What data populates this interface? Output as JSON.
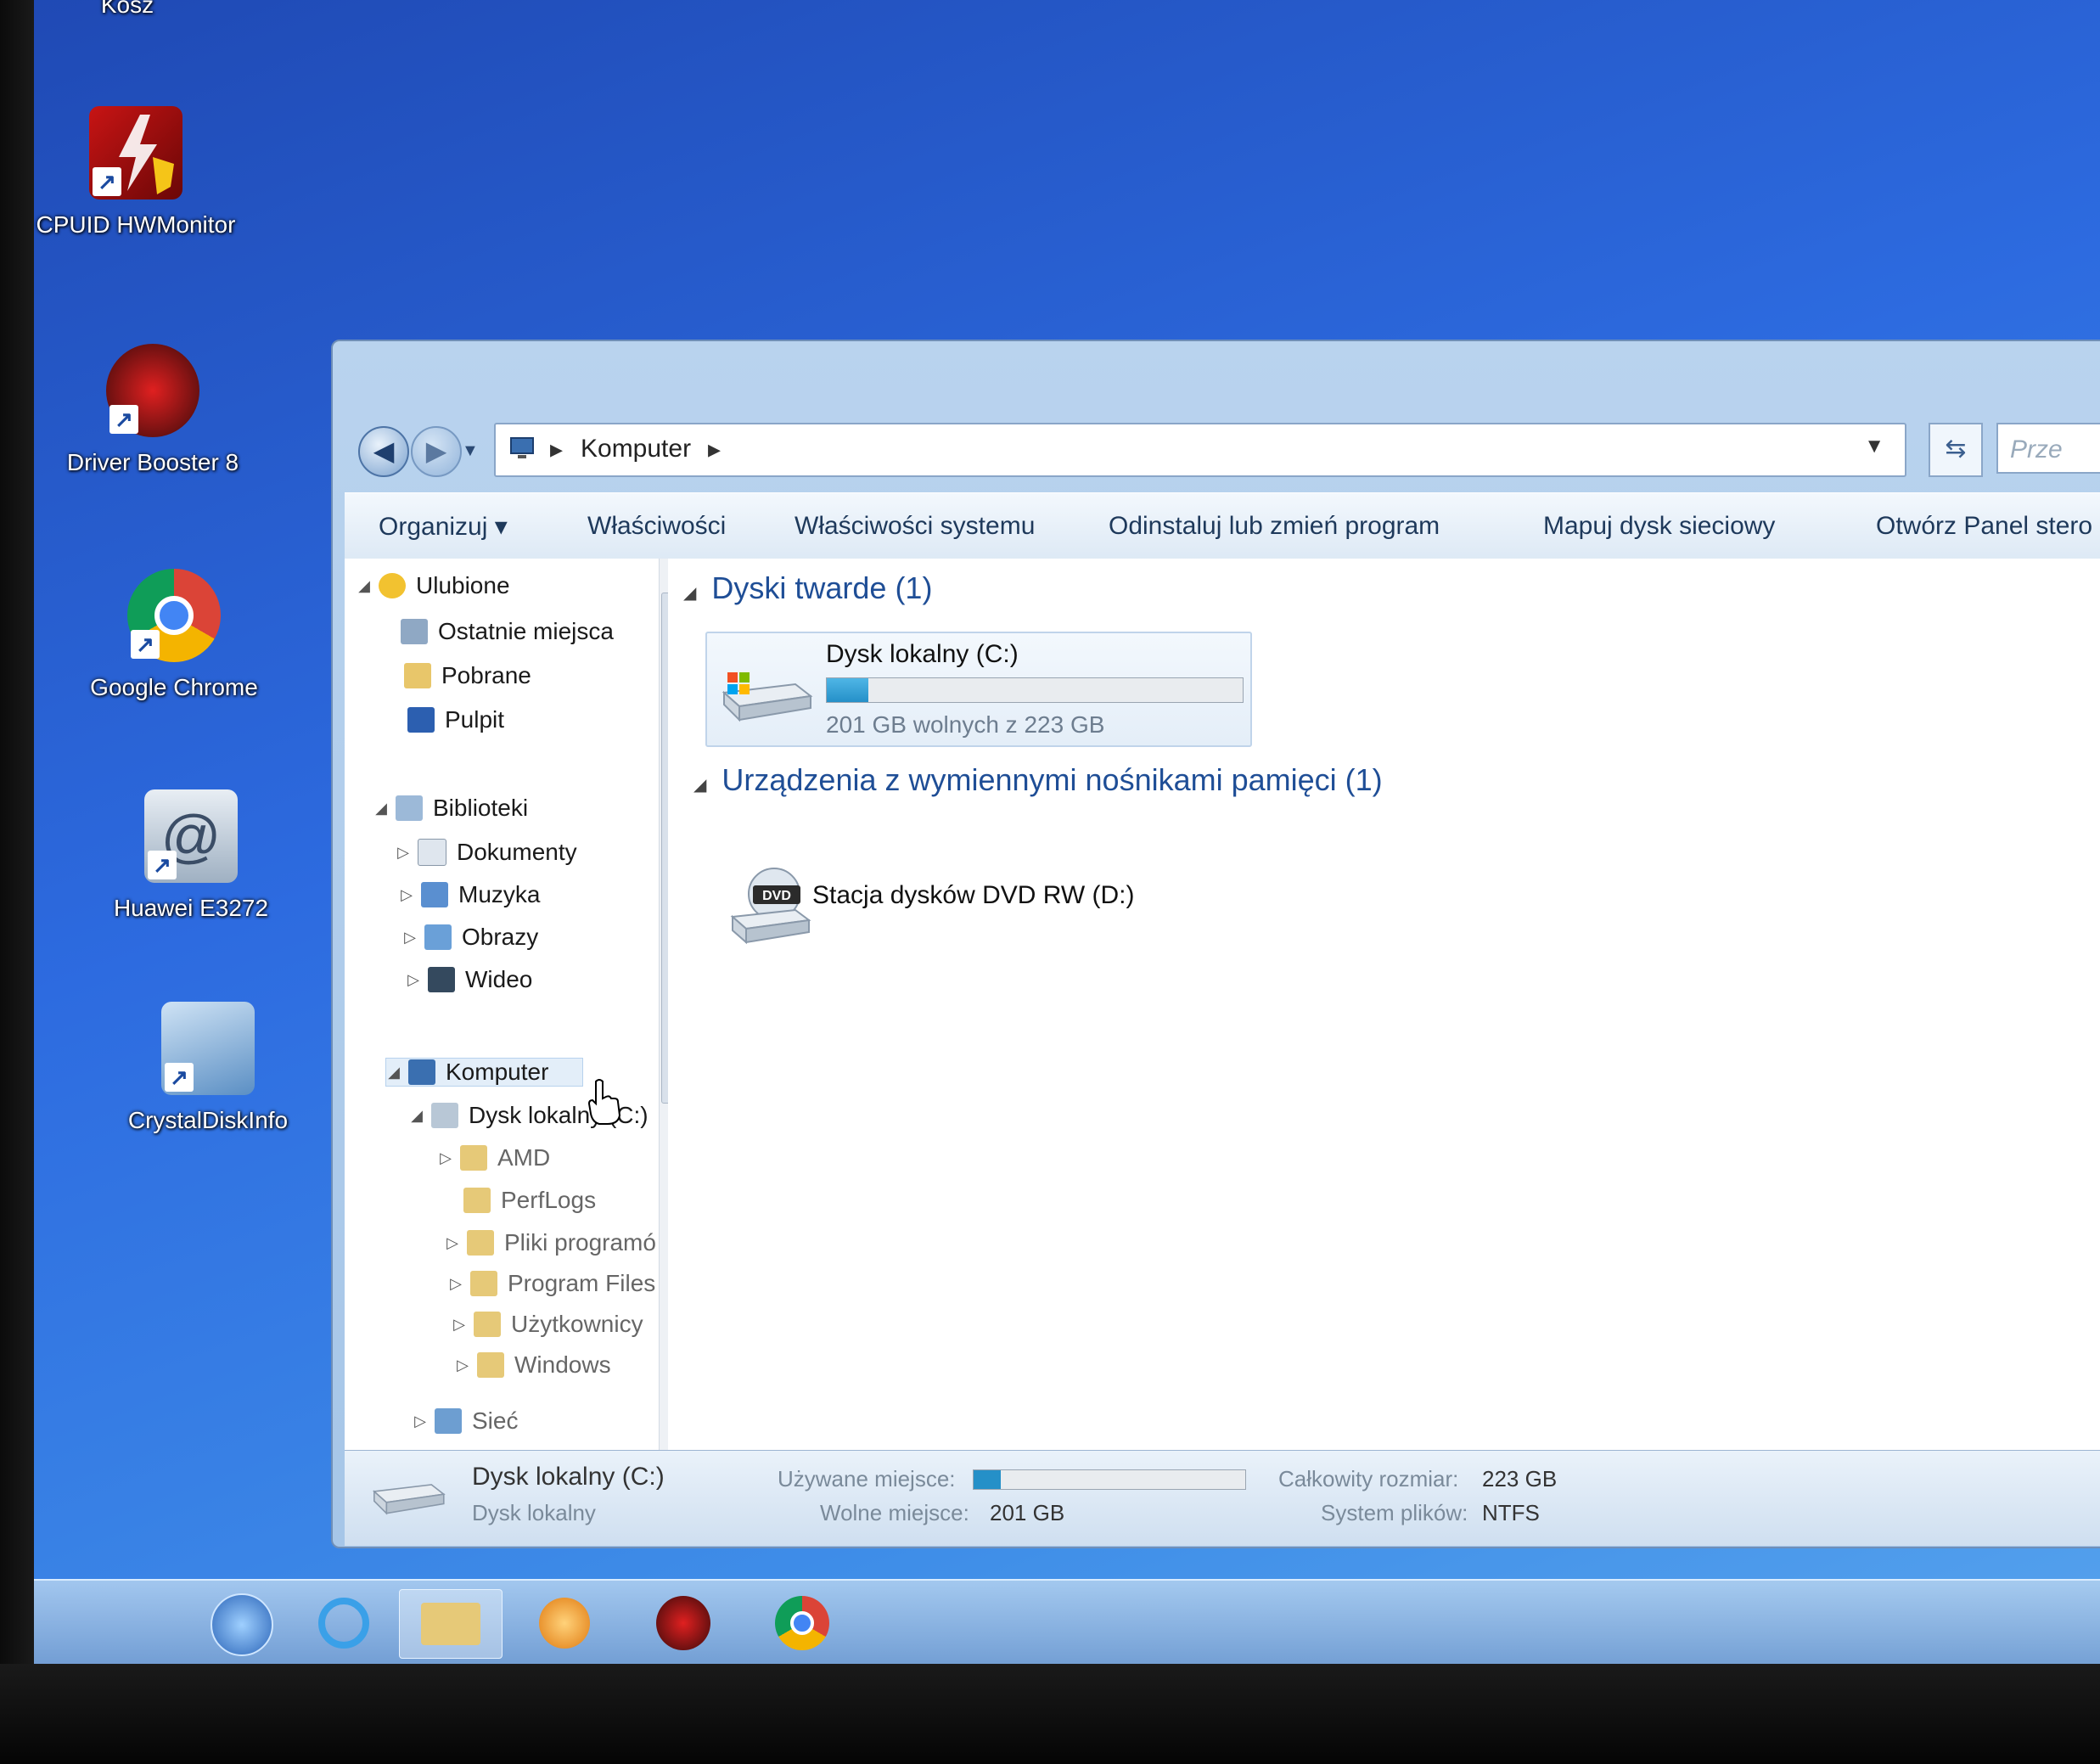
{
  "desktop": {
    "icons": [
      {
        "label": "Kosz"
      },
      {
        "label": "CPUID HWMonitor"
      },
      {
        "label": "Driver Booster 8"
      },
      {
        "label": "Google Chrome"
      },
      {
        "label": "Huawei E3272"
      },
      {
        "label": "CrystalDiskInfo"
      }
    ]
  },
  "explorer": {
    "address": {
      "crumb": "Komputer"
    },
    "search": {
      "placeholder": "Prze"
    },
    "toolbar": {
      "organize": "Organizuj ▾",
      "properties": "Właściwości",
      "system_properties": "Właściwości systemu",
      "uninstall": "Odinstaluj lub zmień program",
      "map_drive": "Mapuj dysk sieciowy",
      "control_panel": "Otwórz Panel stero"
    },
    "nav": {
      "favorites": "Ulubione",
      "recent": "Ostatnie miejsca",
      "downloads": "Pobrane",
      "desktop": "Pulpit",
      "libraries": "Biblioteki",
      "documents": "Dokumenty",
      "music": "Muzyka",
      "pictures": "Obrazy",
      "videos": "Wideo",
      "computer": "Komputer",
      "local_disk": "Dysk lokalny (C:)",
      "folders": [
        "AMD",
        "PerfLogs",
        "Pliki programó",
        "Program Files",
        "Użytkownicy",
        "Windows"
      ],
      "network": "Sieć"
    },
    "content": {
      "hdd_group": "Dyski twarde (1)",
      "removable_group": "Urządzenia z wymiennymi nośnikami pamięci (1)",
      "drive_c": {
        "name": "Dysk lokalny (C:)",
        "free_text": "201 GB wolnych z 223 GB",
        "used_fraction": 0.1
      },
      "dvd": {
        "name": "Stacja dysków DVD RW (D:)",
        "badge": "DVD"
      }
    },
    "details": {
      "title": "Dysk lokalny (C:)",
      "subtitle": "Dysk lokalny",
      "used_label": "Używane miejsce:",
      "free_label": "Wolne miejsce:",
      "free_value": "201 GB",
      "total_label": "Całkowity rozmiar:",
      "total_value": "223 GB",
      "fs_label": "System plików:",
      "fs_value": "NTFS"
    }
  },
  "colors": {
    "accent": "#1f4e96",
    "desktop": "#2d6be0",
    "bar_fill": "#2590c8"
  }
}
